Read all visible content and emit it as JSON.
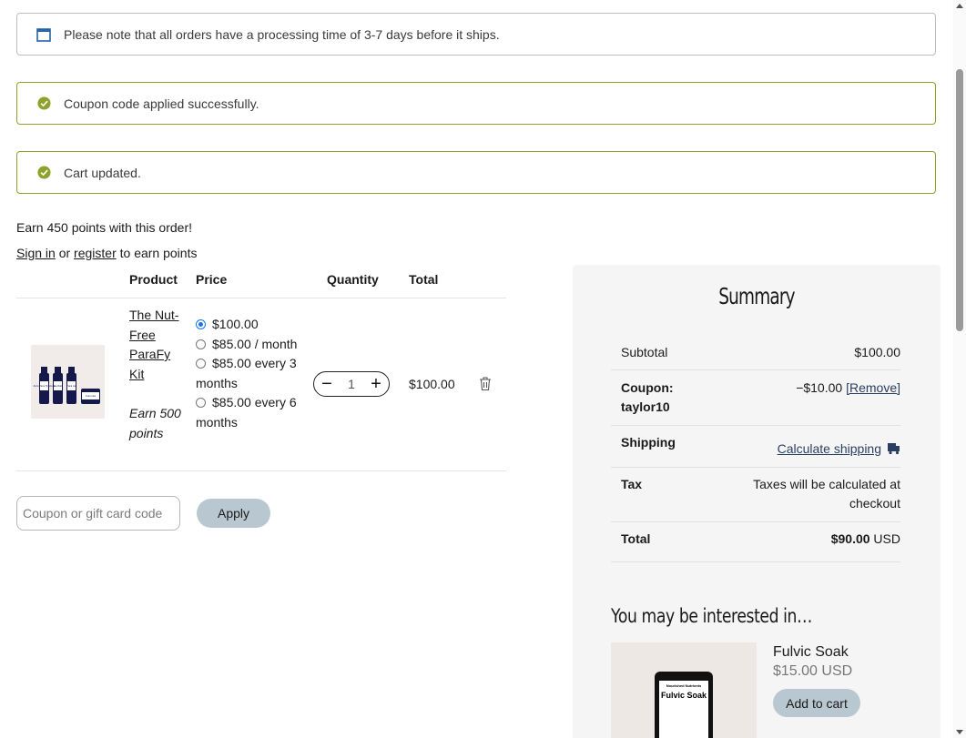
{
  "notices": {
    "info": "Please note that all orders have a processing time of 3-7 days before it ships.",
    "coupon": "Coupon code applied successfully.",
    "cart": "Cart updated."
  },
  "points": {
    "earn": "Earn 450 points with this order!",
    "sign_in": "Sign in",
    "or": " or ",
    "register": "register",
    "suffix": " to earn points"
  },
  "cart": {
    "headers": {
      "product": "Product",
      "price": "Price",
      "quantity": "Quantity",
      "total": "Total"
    },
    "item": {
      "name": "The Nut-Free ParaFy Kit",
      "earn": "Earn 500 points",
      "price_options": [
        {
          "label": "$100.00",
          "selected": true
        },
        {
          "label": "$85.00 / month",
          "selected": false
        },
        {
          "label": "$85.00 every 3 months",
          "selected": false
        },
        {
          "label": "$85.00 every 6 months",
          "selected": false
        }
      ],
      "quantity": "1",
      "total": "$100.00",
      "bottle_labels": [
        "Anti-Para Tincture",
        "Herbal",
        "Para Aid",
        "Formula"
      ]
    },
    "coupon_placeholder": "Coupon or gift card code",
    "apply_label": "Apply"
  },
  "summary": {
    "title": "Summary",
    "subtotal_label": "Subtotal",
    "subtotal_value": "$100.00",
    "coupon_label": "Coupon: taylor10",
    "coupon_value": "−$10.00",
    "coupon_remove": "[Remove]",
    "shipping_label": "Shipping",
    "shipping_link": "Calculate shipping",
    "tax_label": "Tax",
    "tax_value": "Taxes will be calculated at checkout",
    "total_label": "Total",
    "total_value": "$90.00",
    "total_currency": " USD"
  },
  "recommend": {
    "title": "You may be interested in…",
    "product_name": "Fulvic Soak",
    "product_price": "$15.00 USD",
    "add_label": "Add to cart",
    "pouch_brand": "Nourished Nutrients",
    "pouch_title": "Fulvic Soak"
  },
  "colors": {
    "success_border": "#8aa32a",
    "success_icon": "#8aa32a",
    "info_icon": "#2563a6",
    "button_bg": "#b8c7d0"
  }
}
